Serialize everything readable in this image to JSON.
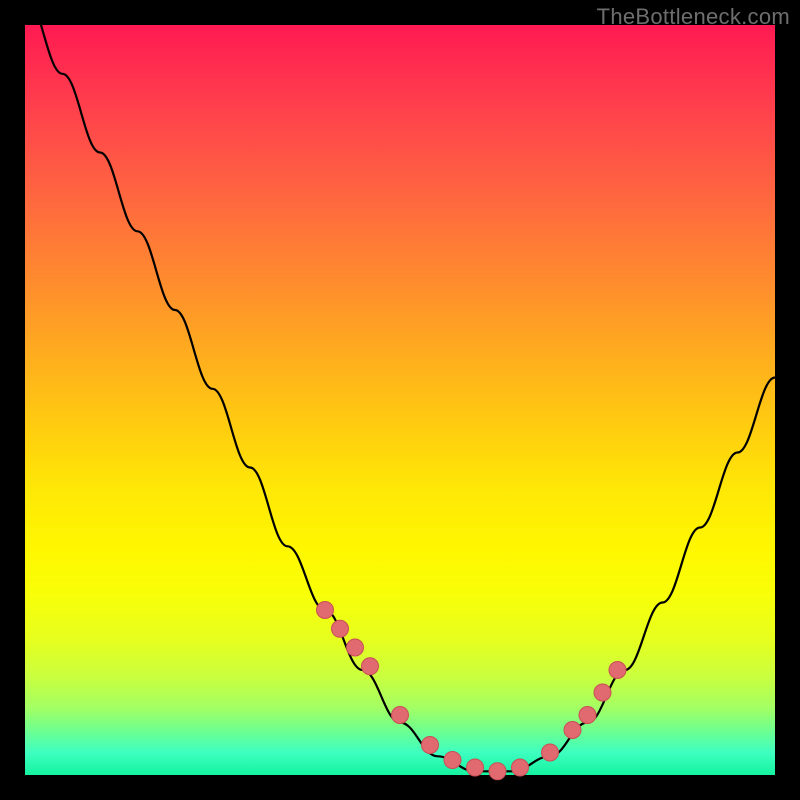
{
  "watermark": "TheBottleneck.com",
  "colors": {
    "background": "#000000",
    "curve_stroke": "#000000",
    "marker_fill": "#e06a6f",
    "marker_stroke": "#c94f55"
  },
  "chart_data": {
    "type": "line",
    "title": "",
    "xlabel": "",
    "ylabel": "",
    "xlim": [
      0,
      100
    ],
    "ylim": [
      0,
      100
    ],
    "series": [
      {
        "name": "bottleneck-curve",
        "x": [
          0,
          5,
          10,
          15,
          20,
          25,
          30,
          35,
          40,
          45,
          50,
          55,
          60,
          65,
          70,
          75,
          80,
          85,
          90,
          95,
          100
        ],
        "y": [
          104,
          93.5,
          83,
          72.5,
          62,
          51.5,
          41,
          30.5,
          22,
          14,
          7,
          2.5,
          0.5,
          0.5,
          2.5,
          7,
          14,
          23,
          33,
          43,
          53
        ]
      }
    ],
    "markers": {
      "name": "highlight-points",
      "x": [
        40,
        42,
        44,
        46,
        50,
        54,
        57,
        60,
        63,
        66,
        70,
        73,
        75,
        77,
        79
      ],
      "y": [
        22,
        19.5,
        17,
        14.5,
        8,
        4,
        2,
        1,
        0.5,
        1,
        3,
        6,
        8,
        11,
        14
      ]
    }
  }
}
